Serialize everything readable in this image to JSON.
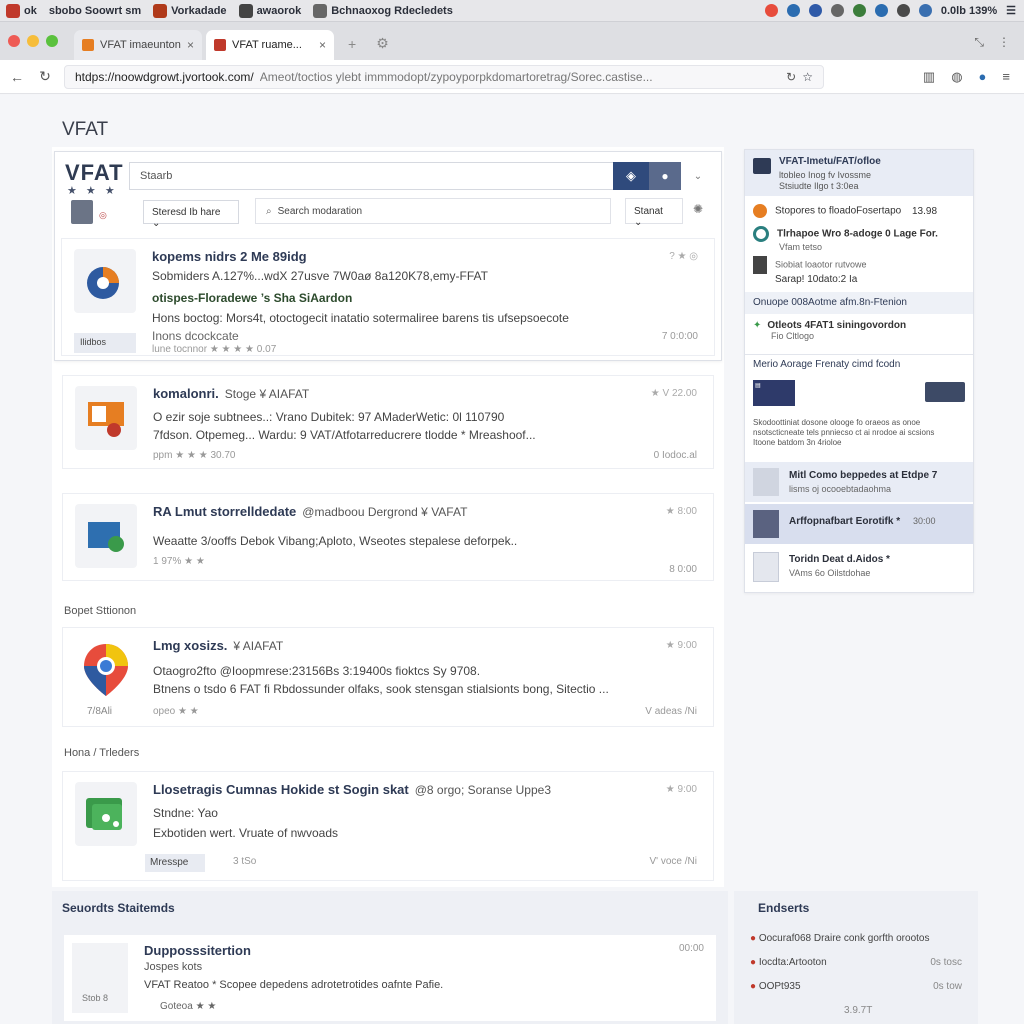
{
  "sysbar": {
    "apps": [
      {
        "label": "ok",
        "color": "#c0392b"
      },
      {
        "label": "sbobo Soowrt sm",
        "color": "#333333"
      },
      {
        "label": "Vorkadade",
        "color": "#b03a1a"
      },
      {
        "label": "awaorok",
        "color": "#444444"
      },
      {
        "label": "Bchnaoxog Rdecledets",
        "color": "#555555"
      }
    ],
    "tray_icons": [
      "#e74c3c",
      "#2b6cb0",
      "#2f5aa8",
      "#666666",
      "#3b7d3b",
      "#2b6cb0",
      "#4a4a4a",
      "#3a6fb0"
    ],
    "status": "0.0lb 139%"
  },
  "tabs": [
    {
      "label": "VFAT imaeunton",
      "fav_color": "#e67e22",
      "active": false
    },
    {
      "label": "VFAT ruame...",
      "fav_color": "#c0392b",
      "active": true
    }
  ],
  "url": {
    "host": "htdps://noowdgrowt.jvortook.com/",
    "path": "Ameot/toctios ylebt immmodopt/zypoyporpkdomartoretrag/Sorec.castise..."
  },
  "page": {
    "heading": "VFAT",
    "logo": "VFAT",
    "stars": "★ ★ ★",
    "search_placeholder": "Staarb",
    "sort_label": "Steresd Ib hare",
    "search_refine_placeholder": "Search modaration",
    "status_label": "Stanat"
  },
  "results": [
    {
      "title": "kopems nidrs 2 Me 89idg",
      "line1": "Sobmiders A.127%...wdX 27usve 7W0aø 8a120K78,emy-FFAT",
      "line2": "otispes-Floradewe ’s Sha SiAardon",
      "line3": "Hons boctog: Mors4t, otoctogecit inatatio sotermaliree barens tis ufsepsoecote",
      "line4": "Inons dcockcate",
      "meta": "lune tocnnor ★ ★ ★ ★ 0.07",
      "date": "7 0:0:00",
      "chip": "Ilidbos",
      "icon": "analytics-icon"
    },
    {
      "title": "komalonri.",
      "title_sub": "Stoge ¥ AIAFAT",
      "line1": "O ezir soje subtnees..: Vrano Dubitek: 97 AMaderWetic: 0l 110790",
      "line2": "7fdson. Otpemeg... Wardu: 9 VAT/Atfotarreducrere tlodde * Mreashoof...",
      "meta": "ppm ★ ★ ★ 30.70",
      "date": "0 Iodoc.al",
      "rate": "★ V 22.00",
      "icon": "presentation-icon"
    },
    {
      "title": "RA Lmut storrelldedate",
      "title_sub": "@madboou Dergrond ¥ VAFAT",
      "line1": "Weaatte 3/ooffs Debok Vibang;Aploto, Wseotes stepalese deforpek..",
      "meta": "1 97% ★ ★",
      "date": "8 0:00",
      "rate": "★ 8:00",
      "icon": "folder-check-icon"
    },
    {
      "section": "Bopet Sttionon",
      "title": "Lmg xosizs.",
      "title_sub": "¥ AIAFAT",
      "line1": "Otaogro2fto @Ioopmrese:23156Bs 3:19400s fioktcs Sy 9708.",
      "line2": "Btnens o tsdo 6 FAT fi Rbdossunder olfaks, sook stensgan stialsionts bong, Sitectio ...",
      "side": "7/8Ali",
      "meta": "opeo ★ ★",
      "date": "V adeas /Ni",
      "rate": "★ 9:00",
      "icon": "map-pin-icon"
    },
    {
      "section": "Hona / Trleders",
      "title": "Llosetragis Cumnas Hokide st Sogin skat",
      "title_sub": "@8 orgo; Soranse Uppe3",
      "line1": "Stndne: Yao",
      "line2": "Exbotiden wert. Vruate of nwvoads",
      "chip": "Mresspe",
      "meta": "3 tSo",
      "date": "V' voce /Ni",
      "rate": "★ 9:00",
      "icon": "gallery-icon"
    }
  ],
  "sidebar": {
    "header_title": "VFAT-Imetu/FAT/ofloe",
    "header_sub": "ltobleo Inog fv Ivossme\nStsiudte Ilgo t 3:0ea",
    "rows": [
      {
        "title": "Stopores to floadoFosertapo",
        "value": "13.98",
        "icon_color": "#e67e22"
      },
      {
        "title": "Tlrhapoe Wro 8-adoge 0 Lage For.",
        "sub": "Vfam tetso",
        "icon_color": "#2a7f7f"
      },
      {
        "title": "Siobiat loaotor rutvowe",
        "sub": "Sarap! 10dato:2 Ia",
        "icon_color": "#444444"
      }
    ],
    "section1": "Onuope 008Aotme afm.8n-Ftenion",
    "featured": "Otleots 4FAT1 siningovordon",
    "featured_sub": "Fio Cltlogo",
    "section2": "Merio Aorage Frenaty cimd fcodn",
    "panel_line1": "Skodoottiniat dosone olooge fo oraeos as onoe",
    "panel_line2": "nsotscticneate tels pnniecso ct ai nrodoe ai scsions",
    "panel_line3": "Itoone batdom 3n 4rioloe",
    "item1_title": "Mitl Como beppedes at Etdpe 7",
    "item1_sub": "lisms oj ocooebtadaohma",
    "item2_title": "Arffopnafbart Eorotifk *",
    "item2_value": "30:00",
    "item3_title": "Toridn Deat d.Aidos *",
    "item3_sub": "VAms 6o Oilstdohae"
  },
  "bottom": {
    "left_heading": "Seuordts Staitemds",
    "item_title": "Dupposssitertion",
    "item_sub": "Jospes kots",
    "item_line": "VFAT Reatoo * Scopee depedens adrotetrotides oafnte Pafie.",
    "item_meta": "Goteoa ★ ★",
    "item_date": "00:00",
    "item_left": "Stob 8",
    "right_heading": "Endserts",
    "right_rows": [
      {
        "label": "Oocuraf068 Draire conk gorfth orootos",
        "value": ""
      },
      {
        "label": "Iocdta:Artooton",
        "value": "0s tosc"
      },
      {
        "label": "OOPt935",
        "value": "0s tow"
      }
    ],
    "right_footer": "3.9.7T"
  }
}
